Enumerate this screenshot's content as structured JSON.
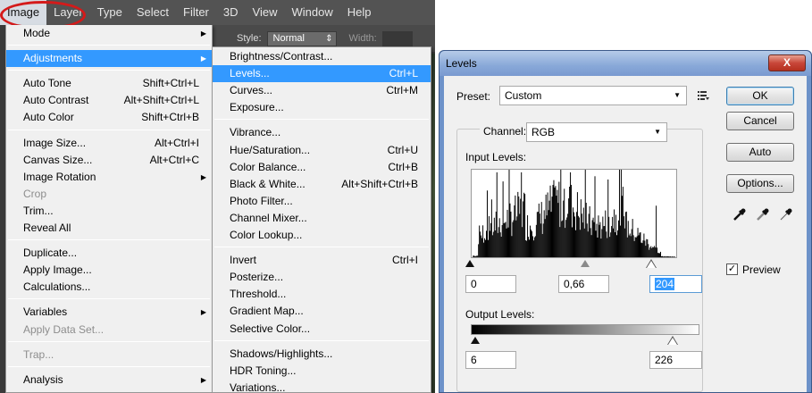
{
  "menubar": {
    "items": [
      "Image",
      "Layer",
      "Type",
      "Select",
      "Filter",
      "3D",
      "View",
      "Window",
      "Help"
    ]
  },
  "options_bar": {
    "style_label": "Style:",
    "style_value": "Normal",
    "width_label": "Width:"
  },
  "image_menu": {
    "items": [
      {
        "label": "Mode",
        "shortcut": "",
        "submenu": true
      },
      {
        "label": "Adjustments",
        "shortcut": "",
        "submenu": true,
        "highlighted": true
      },
      {
        "label": "Auto Tone",
        "shortcut": "Shift+Ctrl+L"
      },
      {
        "label": "Auto Contrast",
        "shortcut": "Alt+Shift+Ctrl+L"
      },
      {
        "label": "Auto Color",
        "shortcut": "Shift+Ctrl+B"
      },
      {
        "label": "Image Size...",
        "shortcut": "Alt+Ctrl+I"
      },
      {
        "label": "Canvas Size...",
        "shortcut": "Alt+Ctrl+C"
      },
      {
        "label": "Image Rotation",
        "shortcut": "",
        "submenu": true
      },
      {
        "label": "Crop",
        "shortcut": "",
        "disabled": true
      },
      {
        "label": "Trim...",
        "shortcut": ""
      },
      {
        "label": "Reveal All",
        "shortcut": ""
      },
      {
        "label": "Duplicate...",
        "shortcut": ""
      },
      {
        "label": "Apply Image...",
        "shortcut": ""
      },
      {
        "label": "Calculations...",
        "shortcut": ""
      },
      {
        "label": "Variables",
        "shortcut": "",
        "submenu": true
      },
      {
        "label": "Apply Data Set...",
        "shortcut": "",
        "disabled": true
      },
      {
        "label": "Trap...",
        "shortcut": "",
        "disabled": true
      },
      {
        "label": "Analysis",
        "shortcut": "",
        "submenu": true
      }
    ]
  },
  "adjustments_menu": {
    "items": [
      {
        "label": "Brightness/Contrast...",
        "shortcut": ""
      },
      {
        "label": "Levels...",
        "shortcut": "Ctrl+L",
        "highlighted": true
      },
      {
        "label": "Curves...",
        "shortcut": "Ctrl+M"
      },
      {
        "label": "Exposure...",
        "shortcut": ""
      },
      {
        "label": "Vibrance...",
        "shortcut": ""
      },
      {
        "label": "Hue/Saturation...",
        "shortcut": "Ctrl+U"
      },
      {
        "label": "Color Balance...",
        "shortcut": "Ctrl+B"
      },
      {
        "label": "Black & White...",
        "shortcut": "Alt+Shift+Ctrl+B"
      },
      {
        "label": "Photo Filter...",
        "shortcut": ""
      },
      {
        "label": "Channel Mixer...",
        "shortcut": ""
      },
      {
        "label": "Color Lookup...",
        "shortcut": ""
      },
      {
        "label": "Invert",
        "shortcut": "Ctrl+I"
      },
      {
        "label": "Posterize...",
        "shortcut": ""
      },
      {
        "label": "Threshold...",
        "shortcut": ""
      },
      {
        "label": "Gradient Map...",
        "shortcut": ""
      },
      {
        "label": "Selective Color...",
        "shortcut": ""
      },
      {
        "label": "Shadows/Highlights...",
        "shortcut": ""
      },
      {
        "label": "HDR Toning...",
        "shortcut": ""
      },
      {
        "label": "Variations...",
        "shortcut": ""
      }
    ]
  },
  "levels_dialog": {
    "title": "Levels",
    "close_label": "X",
    "preset_label": "Preset:",
    "preset_value": "Custom",
    "channel_label": "Channel:",
    "channel_value": "RGB",
    "input_levels_label": "Input Levels:",
    "input_black": "0",
    "input_gamma": "0,66",
    "input_white": "204",
    "output_levels_label": "Output Levels:",
    "output_black": "6",
    "output_white": "226",
    "buttons": {
      "ok": "OK",
      "cancel": "Cancel",
      "auto": "Auto",
      "options": "Options..."
    },
    "preview_label": "Preview",
    "preview_checked": true,
    "check_glyph": "✓"
  },
  "colors": {
    "highlight": "#3399ff",
    "annotation_circle": "#d41a1a"
  }
}
